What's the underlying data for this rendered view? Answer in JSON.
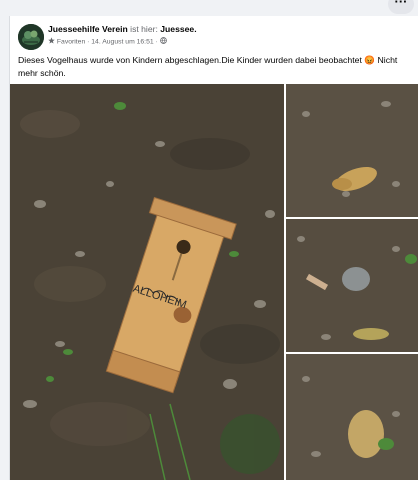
{
  "top_menu": {
    "icon": "more-dots-icon",
    "label": "···"
  },
  "post": {
    "author": "Juesseehilfe Verein",
    "context_text": "ist hier:",
    "location": "Juessee.",
    "audience": "Favoriten",
    "separator": "·",
    "date": "14. August um 16:51",
    "separator2": "·",
    "privacy_icon": "globe-icon",
    "text": "Dieses Vogelhaus wurde von Kindern abgeschlagen.Die Kinder wurden dabei beobachtet 😡 Nicht mehr schön.",
    "photos": [
      {
        "icon": "birdhouse-photo",
        "label": "ALLOHEIM"
      },
      {
        "icon": "debris-photo-1"
      },
      {
        "icon": "debris-photo-2"
      },
      {
        "icon": "debris-photo-3"
      }
    ]
  }
}
